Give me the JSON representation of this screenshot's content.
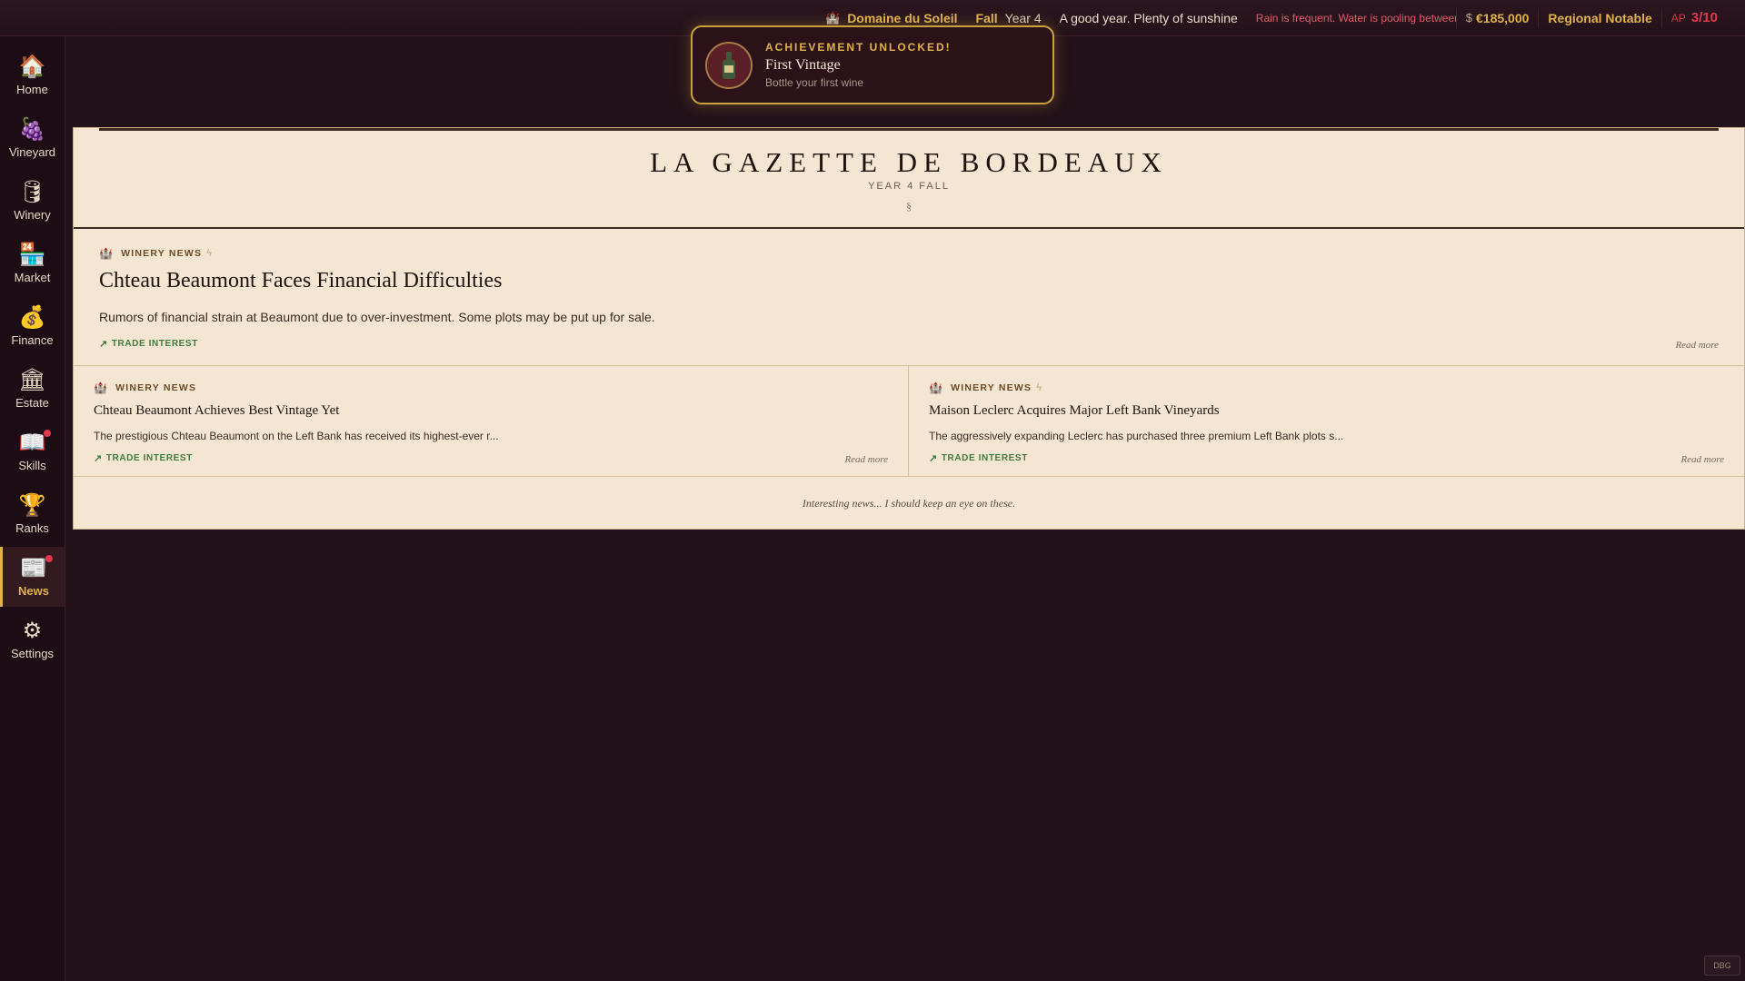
{
  "topbar": {
    "estate_name": "Domaine du Soleil",
    "season": "Fall",
    "year": "Year 4",
    "weather": "A good year. Plenty of sunshine",
    "warning": "Rain is frequent. Water is pooling between the",
    "money_symbol": "$",
    "money": "€185,000",
    "rank": "Regional Notable",
    "ap_label": "AP",
    "ap_value": "3/10"
  },
  "sidebar": {
    "items": [
      {
        "label": "Home",
        "icon": "house-icon"
      },
      {
        "label": "Vineyard",
        "icon": "grapes-icon"
      },
      {
        "label": "Winery",
        "icon": "barrel-icon"
      },
      {
        "label": "Market",
        "icon": "market-stall-icon"
      },
      {
        "label": "Finance",
        "icon": "money-icon"
      },
      {
        "label": "Estate",
        "icon": "building-icon"
      },
      {
        "label": "Skills",
        "icon": "book-icon"
      },
      {
        "label": "Ranks",
        "icon": "trophy-icon"
      },
      {
        "label": "News",
        "icon": "newspaper-icon"
      },
      {
        "label": "Settings",
        "icon": "gear-icon"
      }
    ],
    "active": "News"
  },
  "achievement": {
    "title": "ACHIEVEMENT UNLOCKED!",
    "name": "First Vintage",
    "description": "Bottle your first wine",
    "icon": "wine-bottle-icon"
  },
  "gazette": {
    "title": "LA GAZETTE DE BORDEAUX",
    "subtitle": "YEAR 4 FALL",
    "section_mark": "§",
    "lead": {
      "category": "WINERY NEWS",
      "headline": "Chteau Beaumont Faces Financial Difficulties",
      "summary": "Rumors of financial strain at Beaumont due to over-investment. Some plots may be put up for sale.",
      "trade": "TRADE INTEREST",
      "read_more": "Read more"
    },
    "articles": [
      {
        "category": "WINERY NEWS",
        "headline": "Chteau Beaumont Achieves Best Vintage Yet",
        "summary": "The prestigious Chteau Beaumont on the Left Bank has received its highest-ever r...",
        "trade": "TRADE INTEREST",
        "read_more": "Read more"
      },
      {
        "category": "WINERY NEWS",
        "headline": "Maison Leclerc Acquires Major Left Bank Vineyards",
        "summary": "The aggressively expanding Leclerc has purchased three premium Left Bank plots s...",
        "trade": "TRADE INTEREST",
        "read_more": "Read more"
      }
    ],
    "footer_note": "Interesting news... I should keep an eye on these."
  },
  "debug_button": "DBG"
}
